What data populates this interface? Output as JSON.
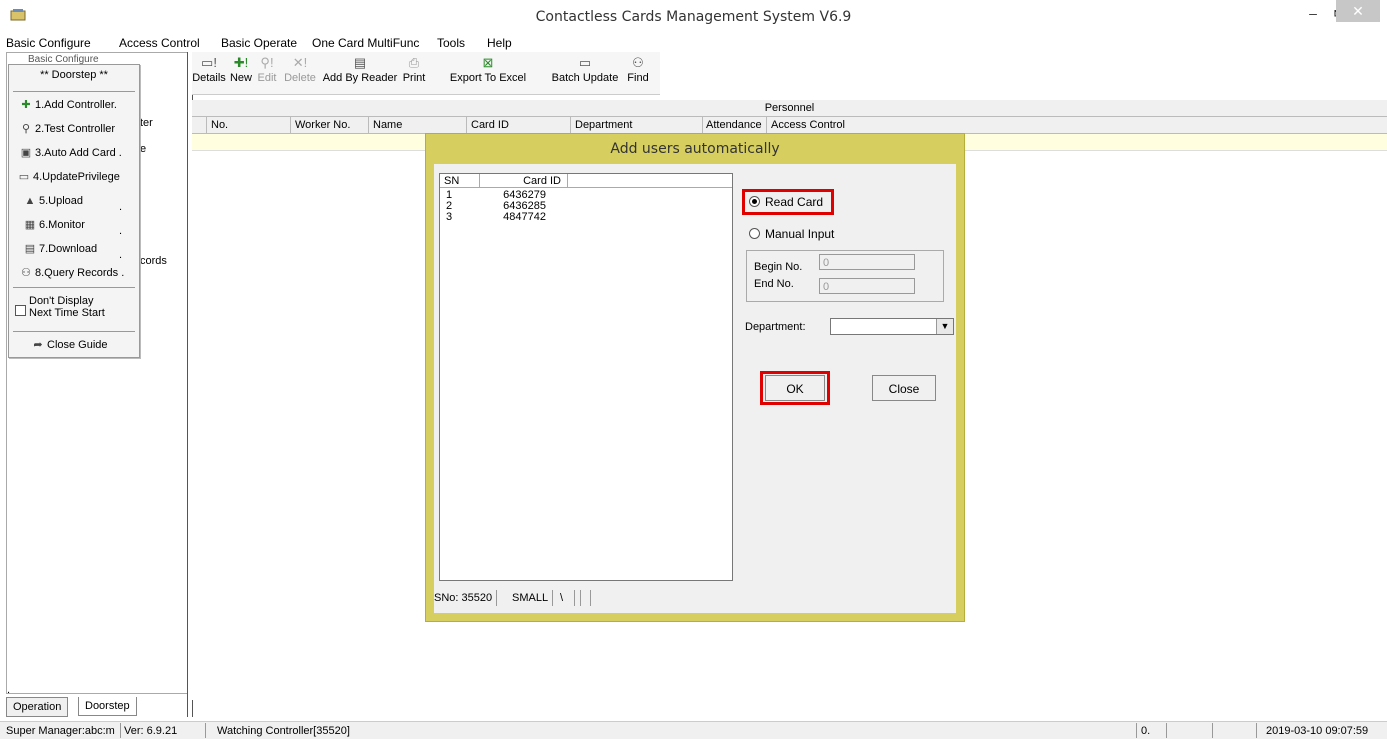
{
  "window": {
    "title": "Contactless Cards Management System  V6.9",
    "minimize": "–",
    "restore": "🗗",
    "close": "✕"
  },
  "menu": [
    "Basic Configure",
    "Access Control",
    "Basic Operate",
    "One Card MultiFunc",
    "Tools",
    "Help"
  ],
  "tree": {
    "top": "Basic Configure",
    "frag1": "ter",
    "frag2": "e",
    "frag3": "cords",
    "frag4": "."
  },
  "guide": {
    "title": "** Doorstep **",
    "items": [
      "1.Add Controller.",
      "2.Test Controller",
      "3.Auto Add Card .",
      "4.UpdatePrivilege",
      "5.Upload",
      "6.Monitor",
      "7.Download",
      "8.Query Records ."
    ],
    "trail": [
      ".",
      ".",
      "."
    ],
    "checkbox_label_1": "Don't Display",
    "checkbox_label_2": "Next Time Start",
    "close": "Close Guide"
  },
  "toolbar": [
    "Details",
    "New",
    "Edit",
    "Delete",
    "Add By Reader",
    "Print",
    "Export To Excel",
    "Batch Update",
    "Find"
  ],
  "grid": {
    "caption": "Personnel",
    "columns": [
      "No.",
      "Worker No.",
      "Name",
      "Card ID",
      "Department",
      "Attendance",
      "Access Control"
    ]
  },
  "tabs": [
    "Operation",
    "Doorstep"
  ],
  "status": {
    "user": "Super Manager:abc:m",
    "version": "Ver: 6.9.21",
    "watch": "Watching Controller[35520]",
    "count": "0.",
    "datetime": "2019-03-10 09:07:59"
  },
  "dialog": {
    "title": "Add users automatically",
    "list_headers": [
      "SN",
      "Card ID"
    ],
    "rows": [
      {
        "sn": "1",
        "card": "6436279"
      },
      {
        "sn": "2",
        "card": "6436285"
      },
      {
        "sn": "3",
        "card": "4847742"
      }
    ],
    "read_card": "Read Card",
    "manual_input": "Manual Input",
    "begin_label": "Begin No.",
    "begin_value": "0",
    "end_label": "End No.",
    "end_value": "0",
    "department_label": "Department:",
    "department_value": "",
    "ok": "OK",
    "close": "Close",
    "status_sno": "SNo: 35520",
    "status_mode": "SMALL",
    "status_spin": "\\"
  }
}
